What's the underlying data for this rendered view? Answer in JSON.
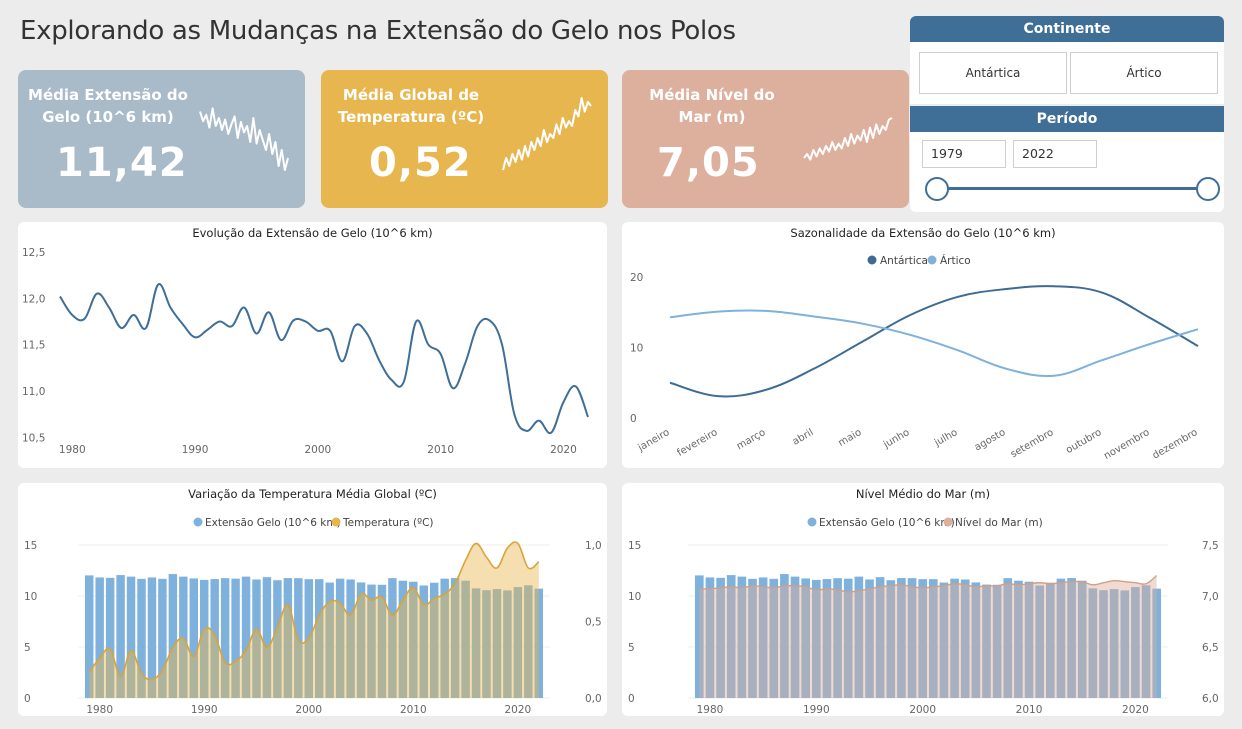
{
  "page": {
    "title": "Explorando as Mudanças na Extensão do Gelo nos Polos"
  },
  "kpis": [
    {
      "title": "Média Extensão do Gelo (10^6 km)",
      "value": "11,42",
      "color": "#a9bac9",
      "spark": [
        0.78,
        0.66,
        0.74,
        0.58,
        0.82,
        0.6,
        0.7,
        0.55,
        0.68,
        0.5,
        0.62,
        0.72,
        0.45,
        0.65,
        0.52,
        0.6,
        0.4,
        0.7,
        0.38,
        0.55,
        0.42,
        0.3,
        0.5,
        0.25,
        0.4,
        0.1,
        0.3,
        0.05,
        0.2
      ]
    },
    {
      "title": "Média Global de Temperatura (ºC)",
      "value": "0,52",
      "color": "#e8b64e",
      "spark": [
        0.05,
        0.2,
        0.1,
        0.25,
        0.15,
        0.3,
        0.18,
        0.35,
        0.22,
        0.4,
        0.3,
        0.45,
        0.35,
        0.55,
        0.4,
        0.5,
        0.45,
        0.62,
        0.5,
        0.7,
        0.58,
        0.66,
        0.6,
        0.8,
        0.72,
        0.95,
        0.78,
        0.9,
        0.85
      ]
    },
    {
      "title": "Média Nível do Mar (m)",
      "value": "7,05",
      "color": "#dcb09c",
      "spark": [
        0.2,
        0.25,
        0.18,
        0.3,
        0.22,
        0.32,
        0.25,
        0.35,
        0.28,
        0.4,
        0.3,
        0.38,
        0.32,
        0.45,
        0.35,
        0.5,
        0.38,
        0.48,
        0.42,
        0.55,
        0.4,
        0.58,
        0.45,
        0.62,
        0.5,
        0.6,
        0.55,
        0.68,
        0.7
      ]
    }
  ],
  "slicer": {
    "continent_header": "Continente",
    "options": [
      "Antártica",
      "Ártico"
    ],
    "period_header": "Período",
    "start": "1979",
    "end": "2022",
    "track_color": "#3f6e97"
  },
  "charts": {
    "extent": {
      "title": "Evolução da Extensão de Gelo (10^6 km)",
      "color": "#3f6e97"
    },
    "seasonal": {
      "title": "Sazonalidade da Extensão do Gelo (10^6 km)",
      "legend": [
        "Antártica",
        "Ártico"
      ],
      "colors": [
        "#3d6b94",
        "#7fb1dd"
      ]
    },
    "temperature": {
      "title": "Variação da Temperatura Média Global (ºC)",
      "legend": [
        "Extensão Gelo (10^6 km)",
        "Temperatura (ºC)"
      ],
      "colors": [
        "#7fb1dd",
        "#e8b64e"
      ]
    },
    "sealevel": {
      "title": "Nível Médio do Mar (m)",
      "legend": [
        "Extensão Gelo (10^6 km)",
        "Nível do Mar (m)"
      ],
      "colors": [
        "#7fb1dd",
        "#dcb09c"
      ]
    }
  },
  "chart_data": [
    {
      "type": "line",
      "title": "Evolução da Extensão de Gelo (10^6 km)",
      "x": [
        1979,
        1980,
        1981,
        1982,
        1983,
        1984,
        1985,
        1986,
        1987,
        1988,
        1989,
        1990,
        1991,
        1992,
        1993,
        1994,
        1995,
        1996,
        1997,
        1998,
        1999,
        2000,
        2001,
        2002,
        2003,
        2004,
        2005,
        2006,
        2007,
        2008,
        2009,
        2010,
        2011,
        2012,
        2013,
        2014,
        2015,
        2016,
        2017,
        2018,
        2019,
        2020,
        2021,
        2022
      ],
      "y": [
        12.02,
        11.82,
        11.78,
        12.05,
        11.9,
        11.68,
        11.82,
        11.68,
        12.15,
        11.9,
        11.72,
        11.58,
        11.66,
        11.75,
        11.7,
        11.9,
        11.62,
        11.85,
        11.55,
        11.76,
        11.75,
        11.65,
        11.65,
        11.32,
        11.7,
        11.62,
        11.33,
        11.12,
        11.1,
        11.75,
        11.5,
        11.4,
        11.03,
        11.3,
        11.7,
        11.76,
        11.5,
        10.75,
        10.57,
        10.68,
        10.55,
        10.88,
        11.05,
        10.72
      ],
      "xticks": [
        1980,
        1990,
        2000,
        2010,
        2020
      ],
      "yticks": [
        "12,5",
        "12,0",
        "11,5",
        "11,0",
        "10,5"
      ],
      "ylim": [
        10.45,
        12.5
      ]
    },
    {
      "type": "line",
      "title": "Sazonalidade da Extensão do Gelo (10^6 km)",
      "categories": [
        "janeiro",
        "fevereiro",
        "março",
        "abril",
        "maio",
        "junho",
        "julho",
        "agosto",
        "setembro",
        "outubro",
        "novembro",
        "dezembro"
      ],
      "series": [
        {
          "name": "Antártica",
          "values": [
            5.0,
            3.1,
            4.0,
            7.0,
            10.8,
            14.6,
            17.2,
            18.3,
            18.7,
            17.8,
            14.2,
            10.2
          ]
        },
        {
          "name": "Ártico",
          "values": [
            14.3,
            15.1,
            15.2,
            14.4,
            13.4,
            11.8,
            9.6,
            7.0,
            6.0,
            8.2,
            10.5,
            12.6
          ]
        }
      ],
      "yticks": [
        "20",
        "10",
        "0"
      ],
      "ylim": [
        0,
        21
      ]
    },
    {
      "type": "bar",
      "title": "Variação da Temperatura Média Global (ºC)",
      "x": [
        1979,
        1980,
        1981,
        1982,
        1983,
        1984,
        1985,
        1986,
        1987,
        1988,
        1989,
        1990,
        1991,
        1992,
        1993,
        1994,
        1995,
        1996,
        1997,
        1998,
        1999,
        2000,
        2001,
        2002,
        2003,
        2004,
        2005,
        2006,
        2007,
        2008,
        2009,
        2010,
        2011,
        2012,
        2013,
        2014,
        2015,
        2016,
        2017,
        2018,
        2019,
        2020,
        2021,
        2022
      ],
      "series": [
        {
          "name": "Extensão Gelo (10^6 km)",
          "values": [
            12.02,
            11.82,
            11.78,
            12.05,
            11.9,
            11.68,
            11.82,
            11.68,
            12.15,
            11.9,
            11.72,
            11.58,
            11.66,
            11.75,
            11.7,
            11.9,
            11.62,
            11.85,
            11.55,
            11.76,
            11.75,
            11.65,
            11.65,
            11.32,
            11.7,
            11.62,
            11.33,
            11.12,
            11.1,
            11.75,
            11.5,
            11.4,
            11.03,
            11.3,
            11.7,
            11.76,
            11.5,
            10.75,
            10.57,
            10.68,
            10.55,
            10.88,
            11.05,
            10.72
          ]
        },
        {
          "name": "Temperatura (ºC)",
          "values": [
            0.17,
            0.26,
            0.32,
            0.14,
            0.31,
            0.16,
            0.12,
            0.18,
            0.33,
            0.39,
            0.27,
            0.45,
            0.41,
            0.23,
            0.24,
            0.31,
            0.45,
            0.33,
            0.46,
            0.61,
            0.38,
            0.39,
            0.54,
            0.63,
            0.62,
            0.54,
            0.68,
            0.64,
            0.66,
            0.54,
            0.64,
            0.72,
            0.61,
            0.65,
            0.68,
            0.75,
            0.9,
            1.01,
            0.92,
            0.85,
            0.98,
            1.01,
            0.85,
            0.89
          ]
        }
      ],
      "yticks": [
        "15",
        "10",
        "5",
        "0"
      ],
      "y2ticks": [
        "1,0",
        "0,5",
        "0,0"
      ],
      "xticks": [
        1980,
        1990,
        2000,
        2010,
        2020
      ],
      "ylim": [
        0,
        15
      ],
      "y2lim": [
        0,
        1.0
      ]
    },
    {
      "type": "bar",
      "title": "Nível Médio do Mar (m)",
      "x": [
        1979,
        1980,
        1981,
        1982,
        1983,
        1984,
        1985,
        1986,
        1987,
        1988,
        1989,
        1990,
        1991,
        1992,
        1993,
        1994,
        1995,
        1996,
        1997,
        1998,
        1999,
        2000,
        2001,
        2002,
        2003,
        2004,
        2005,
        2006,
        2007,
        2008,
        2009,
        2010,
        2011,
        2012,
        2013,
        2014,
        2015,
        2016,
        2017,
        2018,
        2019,
        2020,
        2021,
        2022
      ],
      "series": [
        {
          "name": "Extensão Gelo (10^6 km)",
          "values": [
            12.02,
            11.82,
            11.78,
            12.05,
            11.9,
            11.68,
            11.82,
            11.68,
            12.15,
            11.9,
            11.72,
            11.58,
            11.66,
            11.75,
            11.7,
            11.9,
            11.62,
            11.85,
            11.55,
            11.76,
            11.75,
            11.65,
            11.65,
            11.32,
            11.7,
            11.62,
            11.33,
            11.12,
            11.1,
            11.75,
            11.5,
            11.4,
            11.03,
            11.3,
            11.7,
            11.76,
            11.5,
            10.75,
            10.57,
            10.68,
            10.55,
            10.88,
            11.05,
            10.72
          ]
        },
        {
          "name": "Nível do Mar (m)",
          "values": [
            7.07,
            7.07,
            7.08,
            7.09,
            7.08,
            7.1,
            7.09,
            7.08,
            7.1,
            7.1,
            7.09,
            7.06,
            7.07,
            7.06,
            7.04,
            7.05,
            7.07,
            7.09,
            7.1,
            7.11,
            7.09,
            7.08,
            7.09,
            7.1,
            7.12,
            7.11,
            7.09,
            7.1,
            7.1,
            7.12,
            7.11,
            7.12,
            7.13,
            7.12,
            7.13,
            7.14,
            7.14,
            7.11,
            7.13,
            7.15,
            7.14,
            7.13,
            7.12,
            7.2
          ]
        }
      ],
      "yticks": [
        "15",
        "10",
        "5",
        "0"
      ],
      "y2ticks": [
        "7,5",
        "7,0",
        "6,5",
        "6,0"
      ],
      "xticks": [
        1980,
        1990,
        2000,
        2010,
        2020
      ],
      "ylim": [
        0,
        15
      ],
      "y2lim": [
        6.0,
        7.5
      ]
    }
  ]
}
